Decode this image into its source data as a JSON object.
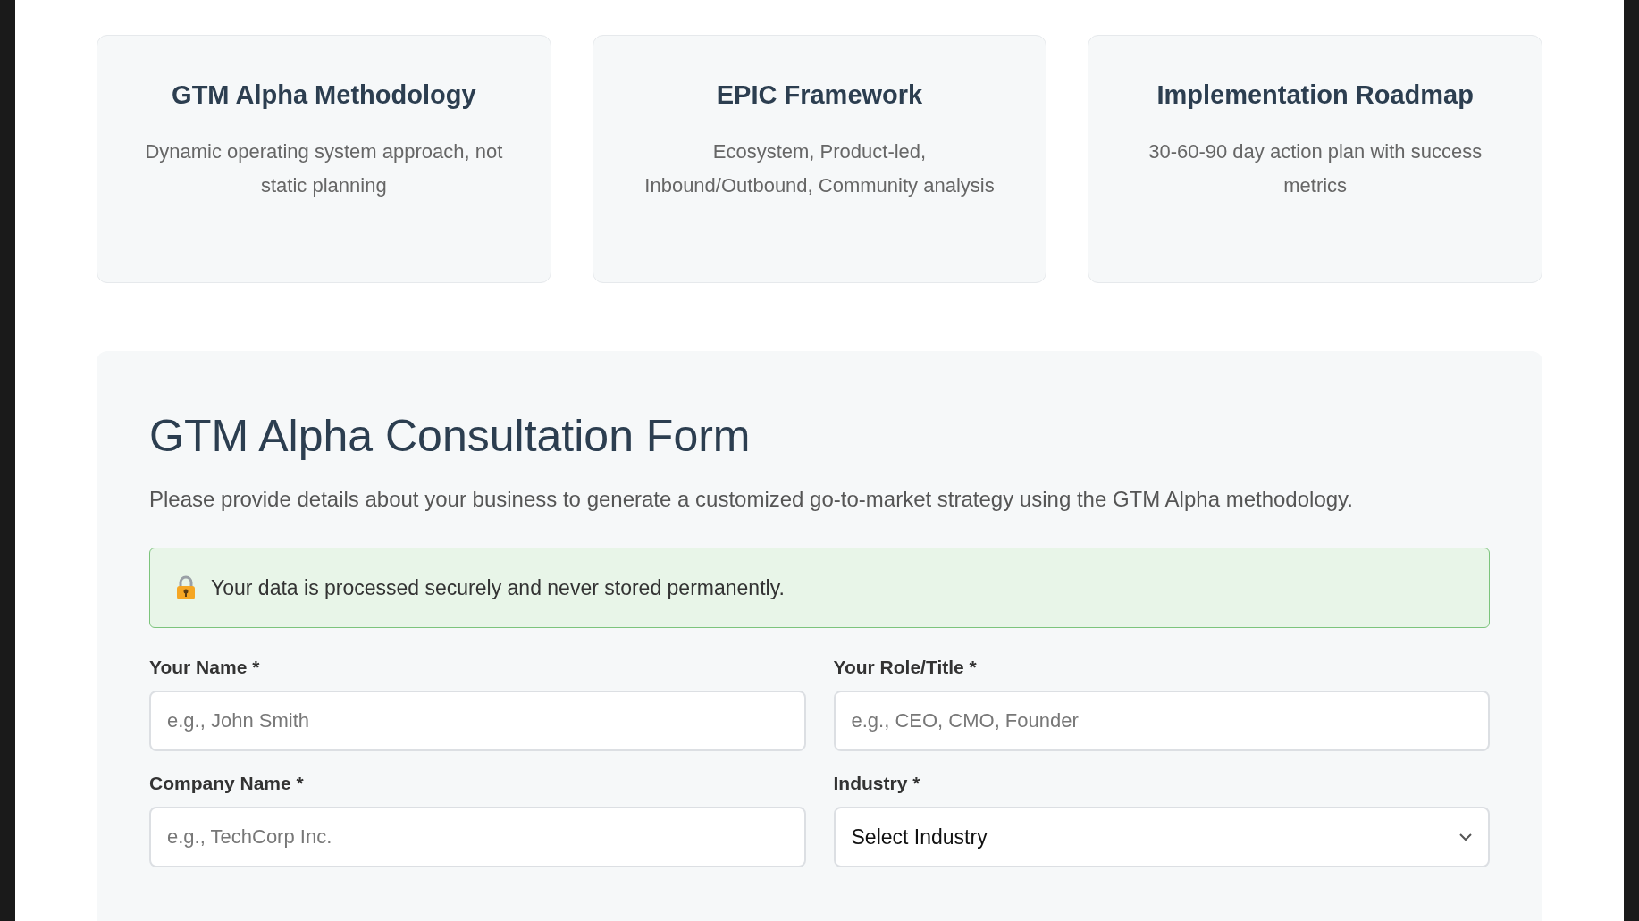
{
  "cards": [
    {
      "title": "GTM Alpha Methodology",
      "description": "Dynamic operating system approach, not static planning"
    },
    {
      "title": "EPIC Framework",
      "description": "Ecosystem, Product-led, Inbound/Outbound, Community analysis"
    },
    {
      "title": "Implementation Roadmap",
      "description": "30-60-90 day action plan with success metrics"
    }
  ],
  "form": {
    "title": "GTM Alpha Consultation Form",
    "description": "Please provide details about your business to generate a customized go-to-market strategy using the GTM Alpha methodology.",
    "notice": "Your data is processed securely and never stored permanently.",
    "fields": [
      {
        "kind": "text",
        "label": "Your Name *",
        "placeholder": "e.g., John Smith"
      },
      {
        "kind": "text",
        "label": "Your Role/Title *",
        "placeholder": "e.g., CEO, CMO, Founder"
      },
      {
        "kind": "text",
        "label": "Company Name *",
        "placeholder": "e.g., TechCorp Inc."
      },
      {
        "kind": "select",
        "label": "Industry *",
        "value": "Select Industry"
      }
    ]
  }
}
